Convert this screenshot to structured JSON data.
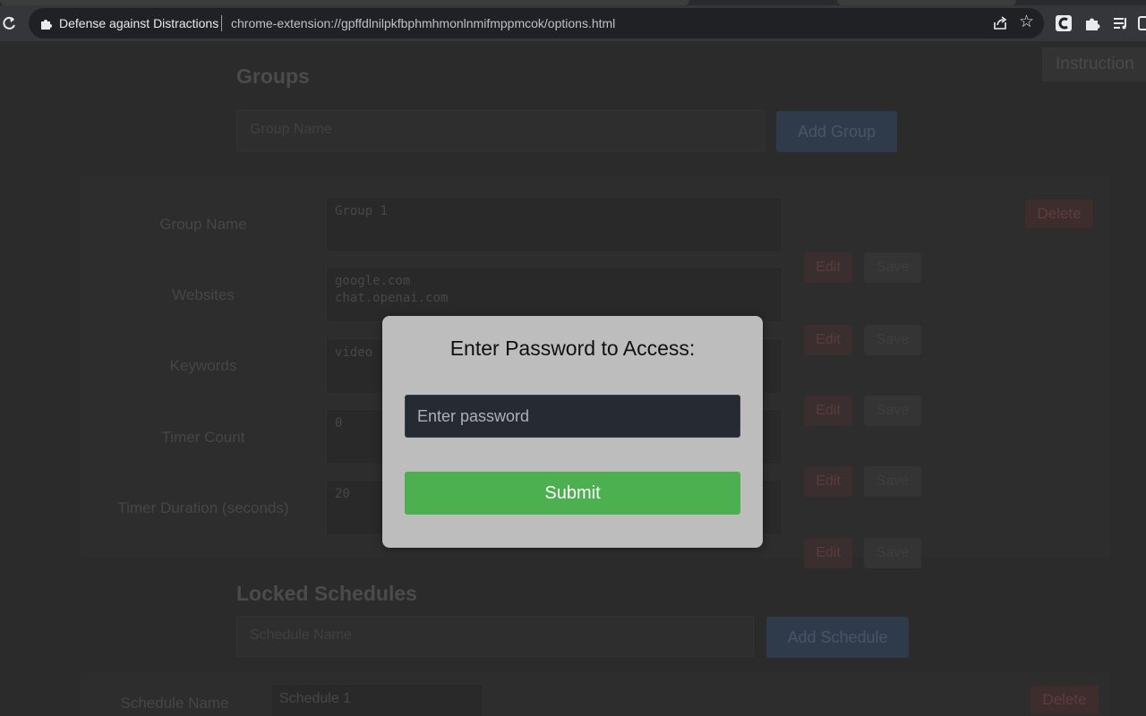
{
  "browser": {
    "site_name": "Defense against Distractions",
    "url": "chrome-extension://gpffdlnilpkfbphmhmonlnmifmppmcok/options.html"
  },
  "header": {
    "instruction_label": "Instruction"
  },
  "groups": {
    "heading": "Groups",
    "input_placeholder": "Group Name",
    "add_button": "Add Group",
    "delete_button": "Delete",
    "rows": [
      {
        "label": "Group Name",
        "value": "Group 1",
        "edit": "Edit",
        "save": "Save"
      },
      {
        "label": "Websites",
        "value": "google.com\nchat.openai.com",
        "edit": "Edit",
        "save": "Save"
      },
      {
        "label": "Keywords",
        "value": "video",
        "edit": "Edit",
        "save": "Save"
      },
      {
        "label": "Timer Count",
        "value": "0",
        "edit": "Edit",
        "save": "Save"
      },
      {
        "label": "Timer Duration (seconds)",
        "value": "20",
        "edit": "Edit",
        "save": "Save"
      }
    ]
  },
  "schedules": {
    "heading": "Locked Schedules",
    "input_placeholder": "Schedule Name",
    "add_button": "Add Schedule",
    "row_label": "Schedule Name",
    "row_value": "Schedule 1",
    "delete_button": "Delete"
  },
  "modal": {
    "title": "Enter Password to Access:",
    "password_placeholder": "Enter password",
    "password_value": "",
    "submit_label": "Submit"
  },
  "colors": {
    "submit_green": "#4caf50",
    "modal_bg": "#bdbdbd",
    "page_overlay": "#2b2b2b"
  },
  "icons": [
    "reload-icon",
    "extension-puzzle-icon",
    "share-icon",
    "star-icon",
    "extension-c-icon",
    "extensions-icon",
    "media-queue-icon",
    "side-panel-icon"
  ]
}
